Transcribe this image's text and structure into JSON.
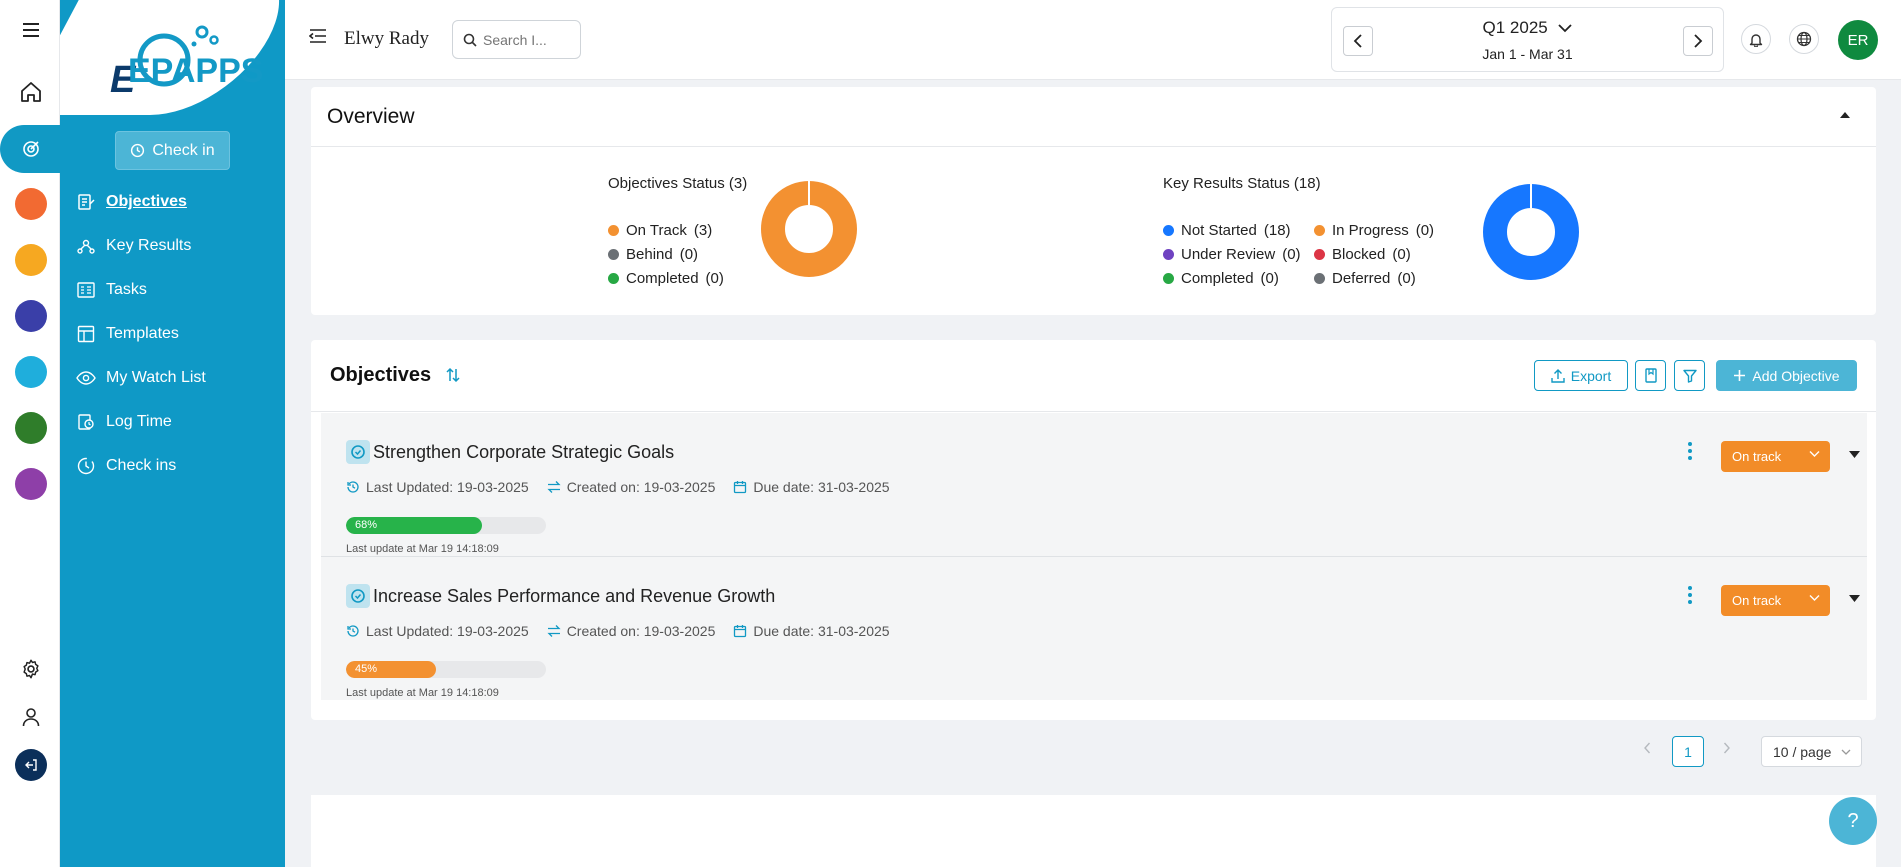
{
  "brand": {
    "logo_text": "EPAPPS"
  },
  "sidebar": {
    "checkin_label": "Check in",
    "items": [
      {
        "label": "Objectives",
        "icon": "objectives-icon"
      },
      {
        "label": "Key Results",
        "icon": "key-results-icon"
      },
      {
        "label": "Tasks",
        "icon": "tasks-icon"
      },
      {
        "label": "Templates",
        "icon": "templates-icon"
      },
      {
        "label": "My Watch List",
        "icon": "eye-icon"
      },
      {
        "label": "Log Time",
        "icon": "log-time-icon"
      },
      {
        "label": "Check ins",
        "icon": "check-ins-icon"
      }
    ]
  },
  "rail_colors": [
    "#f26a32",
    "#f6a821",
    "#3a3fa8",
    "#1faedc",
    "#2f7d2a",
    "#8e3fa8",
    "#0b2f5a"
  ],
  "header": {
    "user_name": "Elwy Rady",
    "search_placeholder": "Search I...",
    "period_title": "Q1 2025",
    "period_range": "Jan 1 - Mar 31",
    "avatar_initials": "ER"
  },
  "overview": {
    "title": "Overview",
    "objectives_status": {
      "title": "Objectives Status (3)",
      "legend": [
        {
          "label": "On Track",
          "count": "(3)",
          "color": "#f39131"
        },
        {
          "label": "Behind",
          "count": "(0)",
          "color": "#6b7075"
        },
        {
          "label": "Completed",
          "count": "(0)",
          "color": "#27a844"
        }
      ]
    },
    "key_results_status": {
      "title": "Key Results Status (18)",
      "legend_left": [
        {
          "label": "Not Started",
          "count": "(18)",
          "color": "#1677ff"
        },
        {
          "label": "Under Review",
          "count": "(0)",
          "color": "#6f42c1"
        },
        {
          "label": "Completed",
          "count": "(0)",
          "color": "#27a844"
        }
      ],
      "legend_right": [
        {
          "label": "In Progress",
          "count": "(0)",
          "color": "#f39131"
        },
        {
          "label": "Blocked",
          "count": "(0)",
          "color": "#dc3545"
        },
        {
          "label": "Deferred",
          "count": "(0)",
          "color": "#6b7075"
        }
      ]
    }
  },
  "objectives": {
    "title": "Objectives",
    "export_label": "Export",
    "add_label": "Add Objective",
    "rows": [
      {
        "title": "Strengthen Corporate Strategic Goals",
        "last_updated": "Last Updated: 19-03-2025",
        "created_on": "Created on: 19-03-2025",
        "due_date": "Due date: 31-03-2025",
        "progress": 68,
        "progress_label": "68%",
        "progress_color": "#27b34a",
        "last_update_at": "Last update at Mar 19 14:18:09",
        "status": "On track"
      },
      {
        "title": "Increase Sales Performance and Revenue Growth",
        "last_updated": "Last Updated: 19-03-2025",
        "created_on": "Created on: 19-03-2025",
        "due_date": "Due date: 31-03-2025",
        "progress": 45,
        "progress_label": "45%",
        "progress_color": "#f39131",
        "last_update_at": "Last update at Mar 19 14:18:09",
        "status": "On track"
      }
    ]
  },
  "pagination": {
    "current_page": "1",
    "page_size": "10 / page"
  },
  "help": {
    "label": "?"
  }
}
